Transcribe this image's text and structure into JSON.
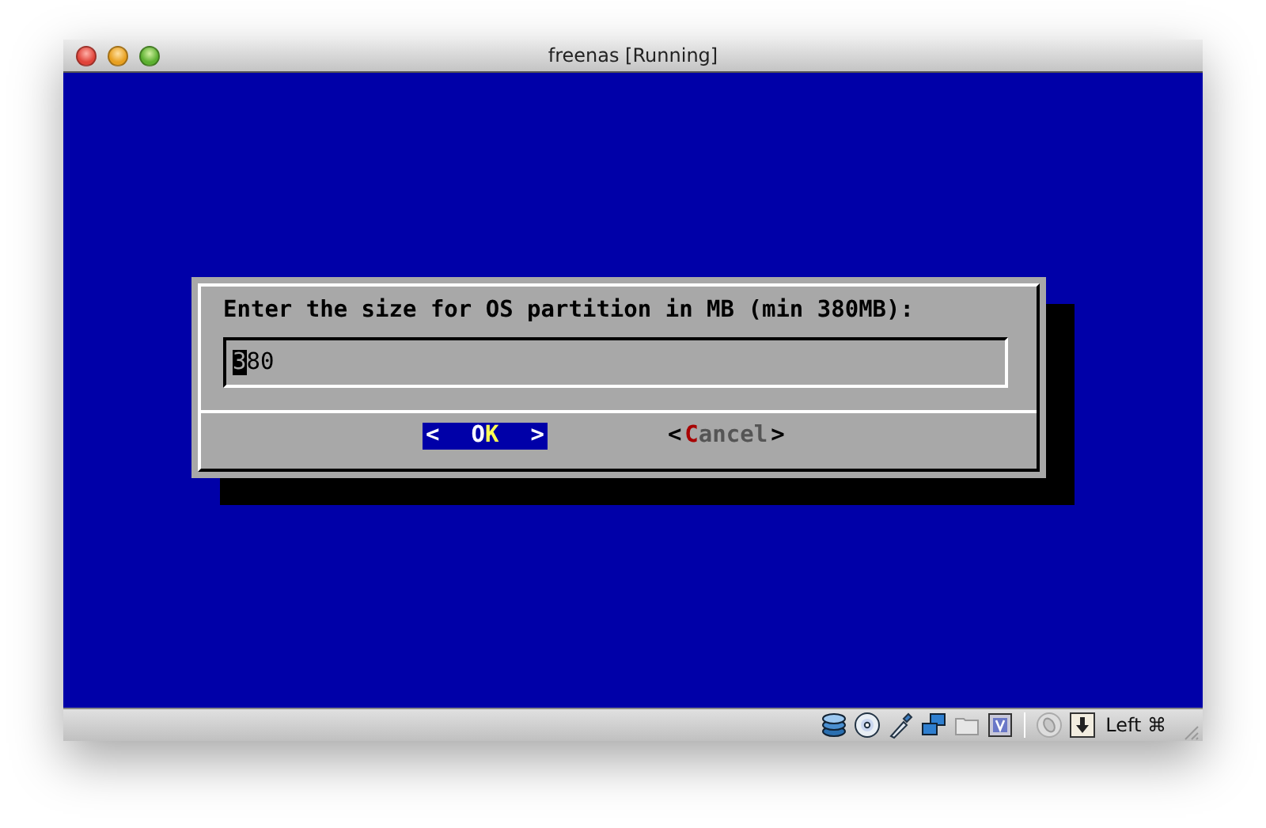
{
  "window": {
    "title": "freenas [Running]"
  },
  "dialog": {
    "prompt": "Enter the size for OS partition in MB (min 380MB):",
    "value_parts": [
      {
        "text": "3",
        "cursor": true
      },
      {
        "text": "80",
        "cursor": false
      }
    ],
    "buttons": [
      {
        "left": "<",
        "right": ">",
        "selected": true,
        "parts": [
          {
            "text": "O",
            "hotkey": false
          },
          {
            "text": "K",
            "hotkey": true
          }
        ]
      },
      {
        "left": "<",
        "right": ">",
        "selected": false,
        "parts": [
          {
            "text": "C",
            "hotkey": true
          },
          {
            "text": "ancel",
            "hotkey": false
          }
        ]
      }
    ]
  },
  "status_bar": {
    "host_key": "Left ⌘"
  }
}
